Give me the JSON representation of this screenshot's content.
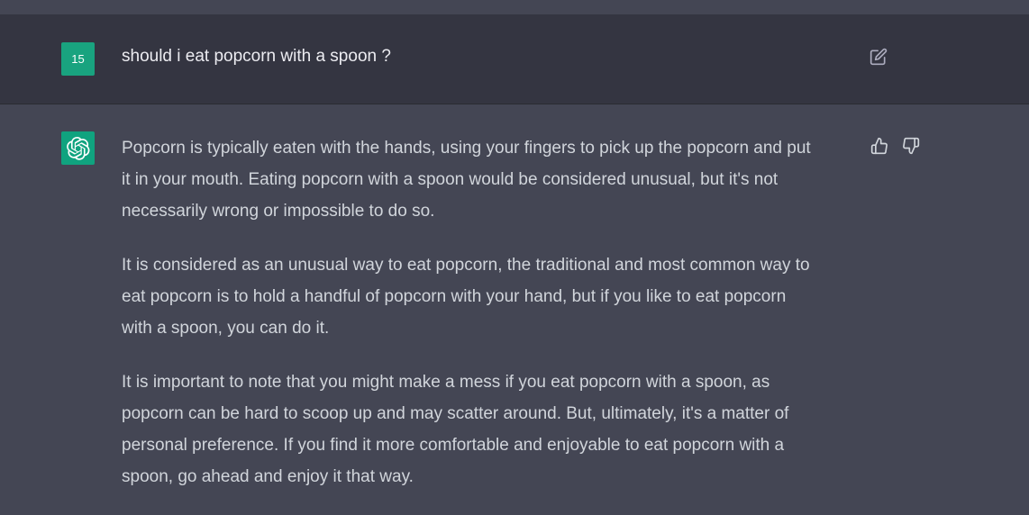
{
  "conversation": {
    "user_message": {
      "avatar_label": "15",
      "text": "should i eat popcorn with a spoon ?"
    },
    "assistant_message": {
      "paragraphs": [
        [
          "Popcorn is typically eaten with the hands, using your fingers to pick up the popcorn and put",
          "it in your mouth. Eating popcorn with a spoon would be considered unusual, but it's not",
          "necessarily wrong or impossible to do so."
        ],
        [
          "It is considered as an unusual way to eat popcorn, the traditional and most common way to",
          "eat popcorn is to hold a handful of popcorn with your hand, but if you like to eat popcorn",
          "with a spoon, you can do it."
        ],
        [
          "It is important to note that you might make a mess if you eat popcorn with a spoon, as",
          "popcorn can be hard to scoop up and may scatter around. But, ultimately, it's a matter of",
          "personal preference. If you find it more comfortable and enjoyable to eat popcorn with a",
          "spoon, go ahead and enjoy it that way."
        ]
      ]
    },
    "icons": {
      "edit": "edit-icon",
      "thumbs_up": "thumbs-up-icon",
      "thumbs_down": "thumbs-down-icon",
      "assistant_logo": "openai-logo-icon"
    },
    "colors": {
      "user_bg": "#343541",
      "assistant_bg": "#444654",
      "avatar_green": "#19a37f",
      "text": "#d1d5db"
    }
  }
}
